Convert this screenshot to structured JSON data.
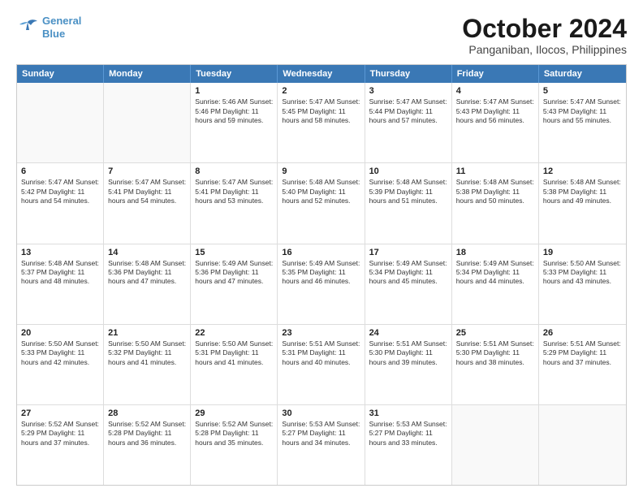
{
  "logo": {
    "line1": "General",
    "line2": "Blue"
  },
  "title": "October 2024",
  "location": "Panganiban, Ilocos, Philippines",
  "header": {
    "days": [
      "Sunday",
      "Monday",
      "Tuesday",
      "Wednesday",
      "Thursday",
      "Friday",
      "Saturday"
    ]
  },
  "weeks": [
    [
      {
        "day": "",
        "info": "",
        "empty": true
      },
      {
        "day": "",
        "info": "",
        "empty": true
      },
      {
        "day": "1",
        "info": "Sunrise: 5:46 AM\nSunset: 5:46 PM\nDaylight: 11 hours and 59 minutes."
      },
      {
        "day": "2",
        "info": "Sunrise: 5:47 AM\nSunset: 5:45 PM\nDaylight: 11 hours and 58 minutes."
      },
      {
        "day": "3",
        "info": "Sunrise: 5:47 AM\nSunset: 5:44 PM\nDaylight: 11 hours and 57 minutes."
      },
      {
        "day": "4",
        "info": "Sunrise: 5:47 AM\nSunset: 5:43 PM\nDaylight: 11 hours and 56 minutes."
      },
      {
        "day": "5",
        "info": "Sunrise: 5:47 AM\nSunset: 5:43 PM\nDaylight: 11 hours and 55 minutes."
      }
    ],
    [
      {
        "day": "6",
        "info": "Sunrise: 5:47 AM\nSunset: 5:42 PM\nDaylight: 11 hours and 54 minutes."
      },
      {
        "day": "7",
        "info": "Sunrise: 5:47 AM\nSunset: 5:41 PM\nDaylight: 11 hours and 54 minutes."
      },
      {
        "day": "8",
        "info": "Sunrise: 5:47 AM\nSunset: 5:41 PM\nDaylight: 11 hours and 53 minutes."
      },
      {
        "day": "9",
        "info": "Sunrise: 5:48 AM\nSunset: 5:40 PM\nDaylight: 11 hours and 52 minutes."
      },
      {
        "day": "10",
        "info": "Sunrise: 5:48 AM\nSunset: 5:39 PM\nDaylight: 11 hours and 51 minutes."
      },
      {
        "day": "11",
        "info": "Sunrise: 5:48 AM\nSunset: 5:38 PM\nDaylight: 11 hours and 50 minutes."
      },
      {
        "day": "12",
        "info": "Sunrise: 5:48 AM\nSunset: 5:38 PM\nDaylight: 11 hours and 49 minutes."
      }
    ],
    [
      {
        "day": "13",
        "info": "Sunrise: 5:48 AM\nSunset: 5:37 PM\nDaylight: 11 hours and 48 minutes."
      },
      {
        "day": "14",
        "info": "Sunrise: 5:48 AM\nSunset: 5:36 PM\nDaylight: 11 hours and 47 minutes."
      },
      {
        "day": "15",
        "info": "Sunrise: 5:49 AM\nSunset: 5:36 PM\nDaylight: 11 hours and 47 minutes."
      },
      {
        "day": "16",
        "info": "Sunrise: 5:49 AM\nSunset: 5:35 PM\nDaylight: 11 hours and 46 minutes."
      },
      {
        "day": "17",
        "info": "Sunrise: 5:49 AM\nSunset: 5:34 PM\nDaylight: 11 hours and 45 minutes."
      },
      {
        "day": "18",
        "info": "Sunrise: 5:49 AM\nSunset: 5:34 PM\nDaylight: 11 hours and 44 minutes."
      },
      {
        "day": "19",
        "info": "Sunrise: 5:50 AM\nSunset: 5:33 PM\nDaylight: 11 hours and 43 minutes."
      }
    ],
    [
      {
        "day": "20",
        "info": "Sunrise: 5:50 AM\nSunset: 5:33 PM\nDaylight: 11 hours and 42 minutes."
      },
      {
        "day": "21",
        "info": "Sunrise: 5:50 AM\nSunset: 5:32 PM\nDaylight: 11 hours and 41 minutes."
      },
      {
        "day": "22",
        "info": "Sunrise: 5:50 AM\nSunset: 5:31 PM\nDaylight: 11 hours and 41 minutes."
      },
      {
        "day": "23",
        "info": "Sunrise: 5:51 AM\nSunset: 5:31 PM\nDaylight: 11 hours and 40 minutes."
      },
      {
        "day": "24",
        "info": "Sunrise: 5:51 AM\nSunset: 5:30 PM\nDaylight: 11 hours and 39 minutes."
      },
      {
        "day": "25",
        "info": "Sunrise: 5:51 AM\nSunset: 5:30 PM\nDaylight: 11 hours and 38 minutes."
      },
      {
        "day": "26",
        "info": "Sunrise: 5:51 AM\nSunset: 5:29 PM\nDaylight: 11 hours and 37 minutes."
      }
    ],
    [
      {
        "day": "27",
        "info": "Sunrise: 5:52 AM\nSunset: 5:29 PM\nDaylight: 11 hours and 37 minutes."
      },
      {
        "day": "28",
        "info": "Sunrise: 5:52 AM\nSunset: 5:28 PM\nDaylight: 11 hours and 36 minutes."
      },
      {
        "day": "29",
        "info": "Sunrise: 5:52 AM\nSunset: 5:28 PM\nDaylight: 11 hours and 35 minutes."
      },
      {
        "day": "30",
        "info": "Sunrise: 5:53 AM\nSunset: 5:27 PM\nDaylight: 11 hours and 34 minutes."
      },
      {
        "day": "31",
        "info": "Sunrise: 5:53 AM\nSunset: 5:27 PM\nDaylight: 11 hours and 33 minutes."
      },
      {
        "day": "",
        "info": "",
        "empty": true
      },
      {
        "day": "",
        "info": "",
        "empty": true
      }
    ]
  ]
}
